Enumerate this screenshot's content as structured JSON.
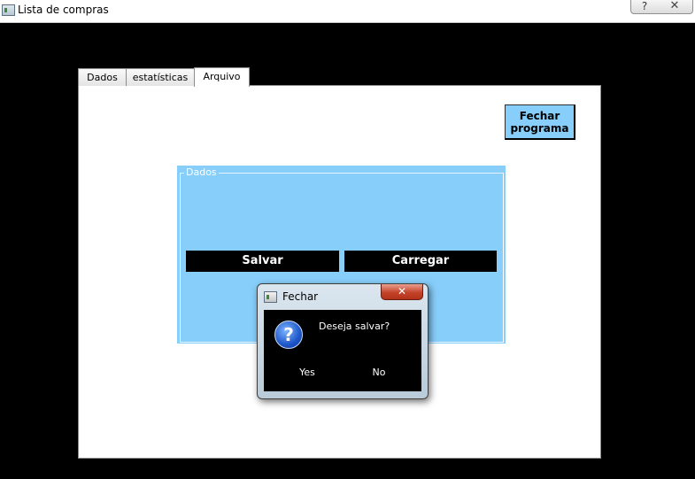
{
  "window": {
    "title": "Lista de compras",
    "help_glyph": "?",
    "close_glyph": "✕"
  },
  "tabs": [
    {
      "label": "Dados",
      "active": false
    },
    {
      "label": "estatísticas",
      "active": false
    },
    {
      "label": "Arquivo",
      "active": true
    }
  ],
  "panel": {
    "close_program_button": "Fechar programa",
    "group_title": "Dados",
    "save_button": "Salvar",
    "load_button": "Carregar"
  },
  "dialog": {
    "title": "Fechar",
    "close_glyph": "✕",
    "message": "Deseja salvar?",
    "yes_button": "Yes",
    "no_button": "No"
  },
  "colors": {
    "accent": "#87cefa",
    "background": "#000000"
  }
}
